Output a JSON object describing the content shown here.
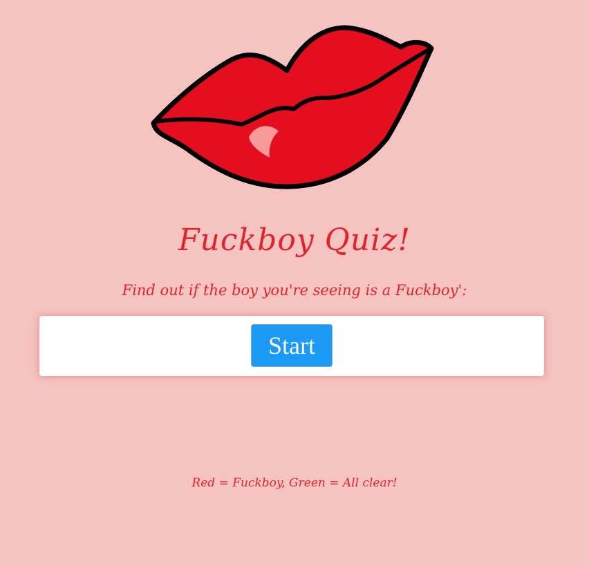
{
  "header": {
    "title": "Fuckboy Quiz!",
    "subtitle": "Find out if the boy you're seeing is a Fuckboy':"
  },
  "quiz": {
    "start_label": "Start"
  },
  "footer": {
    "legend": "Red = Fuckboy, Green = All clear!"
  },
  "colors": {
    "background": "#f5c4c0",
    "accent": "#e0242e",
    "button": "#1a99f5",
    "lips": "#e50e1e"
  },
  "icons": {
    "hero": "lips-icon"
  }
}
